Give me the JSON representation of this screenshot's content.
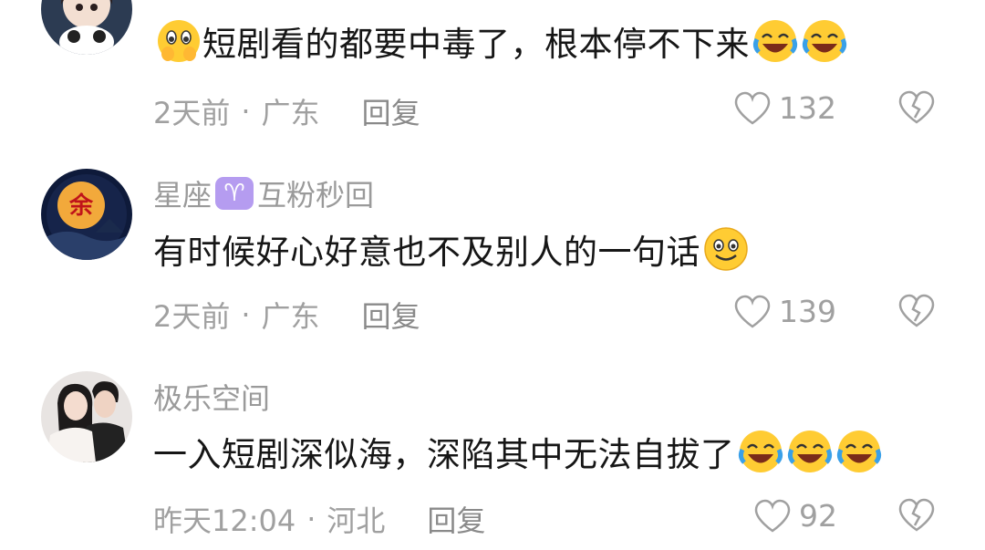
{
  "comments": [
    {
      "username": "",
      "text": "短剧看的都要中毒了，根本停不下来",
      "emojis_before": [
        "cry-pray-emoji"
      ],
      "emojis_after": [
        "laugh-cry-emoji",
        "laugh-cry-emoji"
      ],
      "time": "2天前",
      "location": "广东",
      "reply_label": "回复",
      "likes": "132"
    },
    {
      "username_prefix": "星座",
      "badge_symbol": "♈",
      "username_suffix": "互粉秒回",
      "avatar_char": "余",
      "text": "有时候好心好意也不及别人的一句话",
      "emojis_after": [
        "smile-emoji"
      ],
      "time": "2天前",
      "location": "广东",
      "reply_label": "回复",
      "likes": "139"
    },
    {
      "username": "极乐空间",
      "text": "一入短剧深似海，深陷其中无法自拔了",
      "emojis_after": [
        "laugh-cry-emoji",
        "laugh-cry-emoji",
        "laugh-cry-emoji"
      ],
      "time": "昨天12:04",
      "location": "河北",
      "reply_label": "回复",
      "likes": "92"
    }
  ],
  "separator": "·",
  "colors": {
    "meta": "#a0a0a0",
    "text": "#161616",
    "badge": "#b59cf0"
  }
}
